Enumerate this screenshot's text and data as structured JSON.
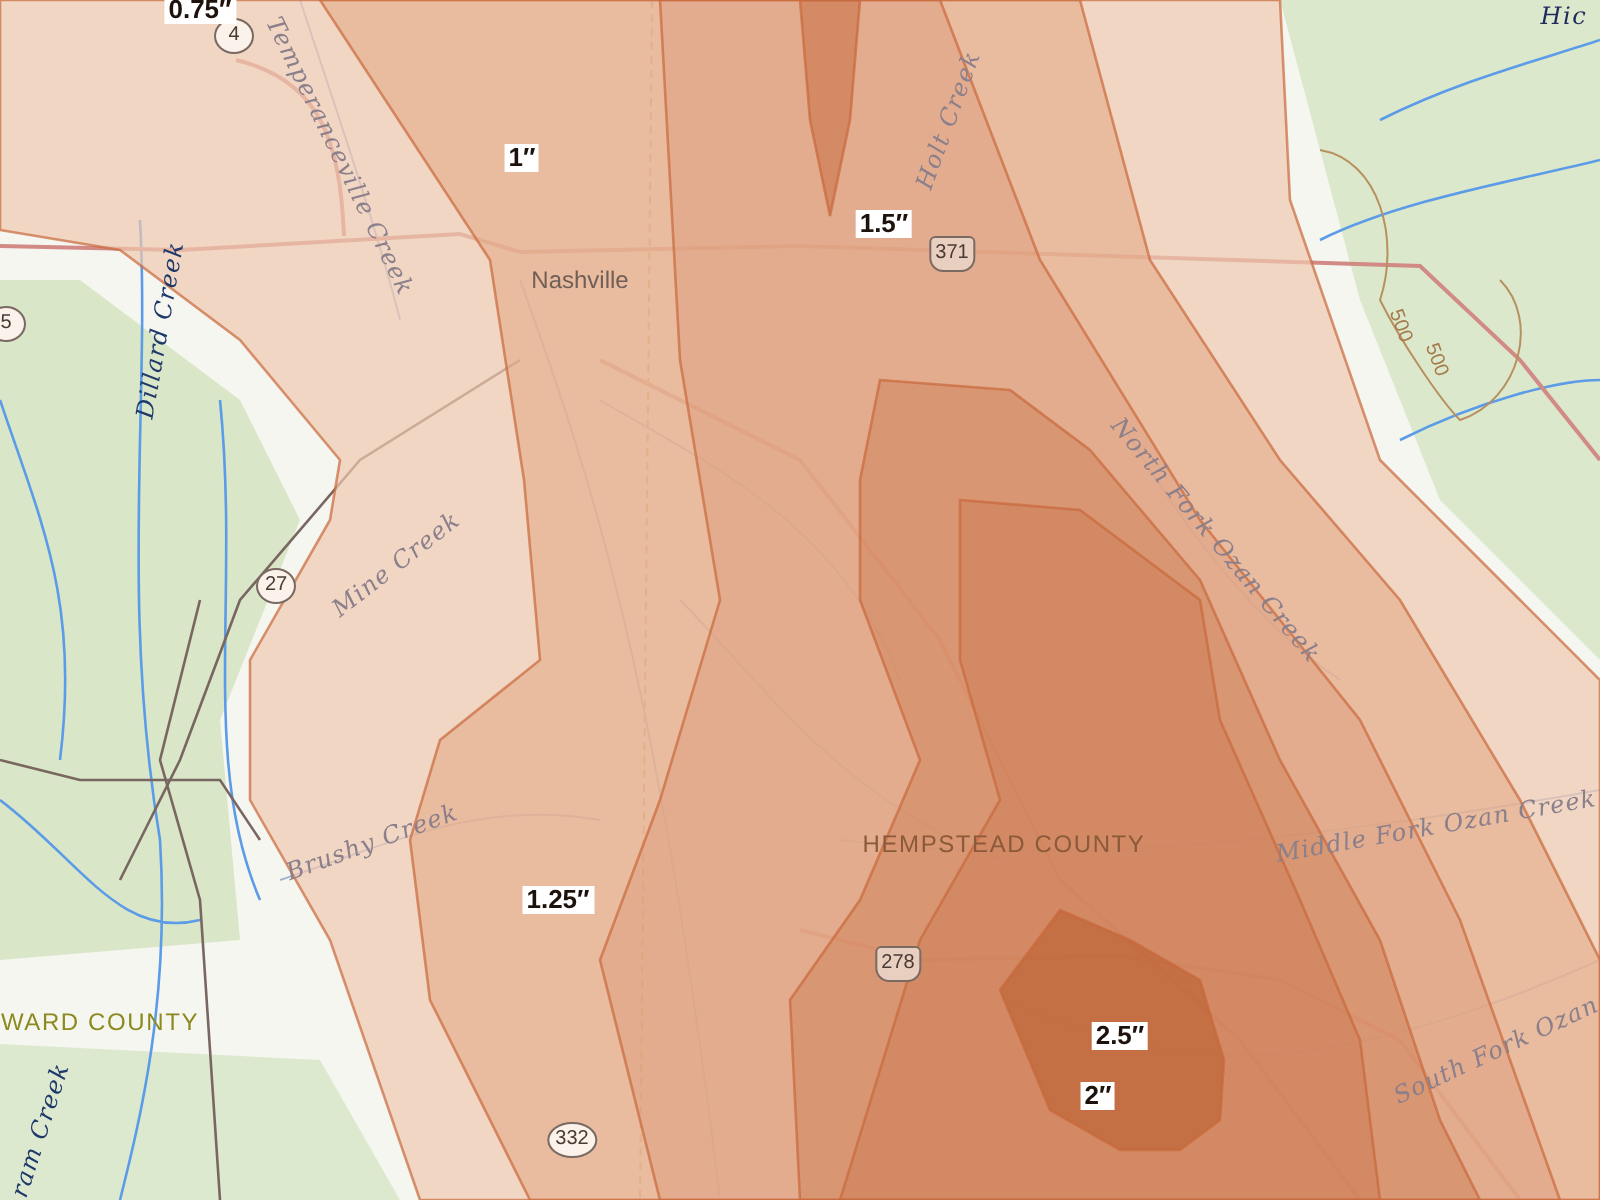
{
  "map": {
    "contour_labels": [
      {
        "text": "0.75″"
      },
      {
        "text": "1″"
      },
      {
        "text": "1.5″"
      },
      {
        "text": "1.25″"
      },
      {
        "text": "2.5″"
      },
      {
        "text": "2″"
      }
    ],
    "places": [
      {
        "text": "Nashville",
        "kind": "city"
      },
      {
        "text": "HEMPSTEAD COUNTY",
        "kind": "county"
      },
      {
        "text": "WARD COUNTY",
        "kind": "county-outside"
      },
      {
        "text": "Hic",
        "kind": "area"
      }
    ],
    "waterways": [
      {
        "text": "Temperanceville Creek"
      },
      {
        "text": "Dillard Creek"
      },
      {
        "text": "Mine Creek"
      },
      {
        "text": "Brushy Creek"
      },
      {
        "text": "Holt Creek"
      },
      {
        "text": "North Fork Ozan Creek"
      },
      {
        "text": "Middle Fork Ozan Creek"
      },
      {
        "text": "South Fork Ozan"
      },
      {
        "text": "ram Creek"
      }
    ],
    "elevation_labels": [
      {
        "text": "500"
      },
      {
        "text": "500"
      }
    ],
    "road_shields": [
      {
        "text": "4",
        "kind": "state"
      },
      {
        "text": "27",
        "kind": "state"
      },
      {
        "text": "371",
        "kind": "us"
      },
      {
        "text": "278",
        "kind": "us"
      },
      {
        "text": "332",
        "kind": "state"
      },
      {
        "text": "5",
        "kind": "state"
      }
    ]
  }
}
